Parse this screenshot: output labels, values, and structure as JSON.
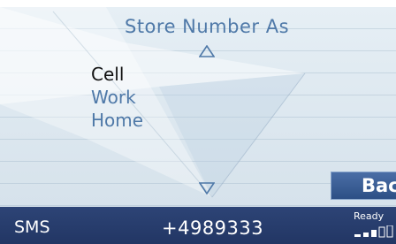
{
  "header": {
    "title": "Store Number As"
  },
  "menu": {
    "scroll_up_icon": "triangle-up-outline",
    "scroll_down_icon": "triangle-down-outline",
    "items": [
      {
        "label": "Cell",
        "selected": true
      },
      {
        "label": "Work",
        "selected": false
      },
      {
        "label": "Home",
        "selected": false
      }
    ]
  },
  "softkey": {
    "back_label": "Back"
  },
  "status": {
    "mode": "SMS",
    "number": "+4989333",
    "ready": "Ready",
    "signal_icon": "signal-strength-icon"
  },
  "colors": {
    "accent_text": "#4f79a8",
    "selected_text": "#111111",
    "status_bar": "#263b6c",
    "button": "#3b5d94"
  }
}
